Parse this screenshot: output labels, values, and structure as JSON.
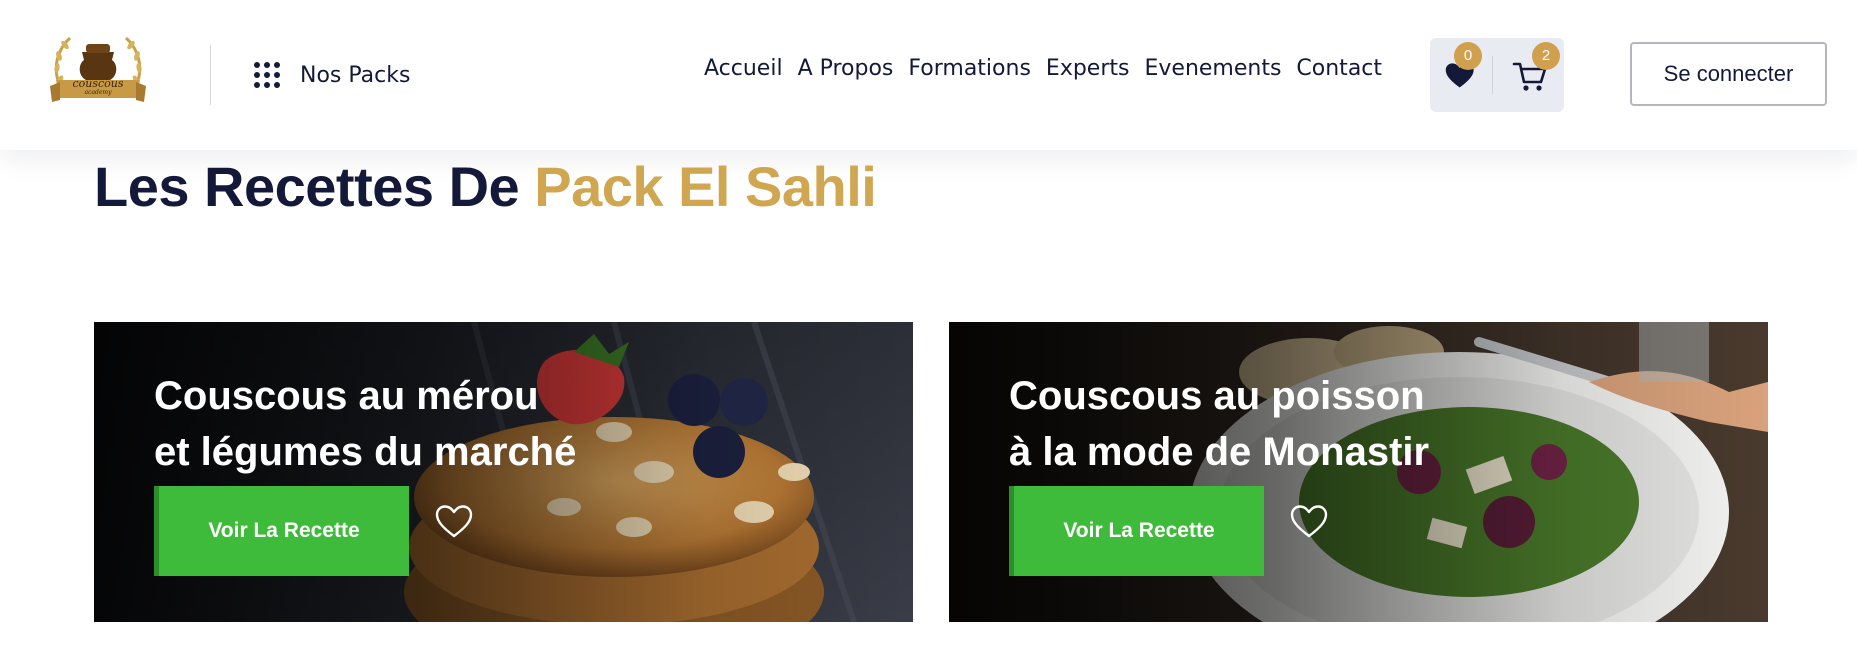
{
  "logo": {
    "word": "couscous",
    "sub": "academy"
  },
  "header": {
    "packs_label": "Nos Packs",
    "nav": [
      {
        "label": "Accueil"
      },
      {
        "label": "A Propos"
      },
      {
        "label": "Formations"
      },
      {
        "label": "Experts"
      },
      {
        "label": "Evenements"
      },
      {
        "label": "Contact"
      }
    ],
    "wishlist_count": "0",
    "cart_count": "2",
    "login_label": "Se connecter"
  },
  "page": {
    "title_part1": "Les Recettes De",
    "title_part2": "Pack El Sahli"
  },
  "recipes": [
    {
      "title_line1": "Couscous au mérou",
      "title_line2": "et légumes du marché",
      "button_label": "Voir La Recette",
      "fav_icon": "heart-outline-icon"
    },
    {
      "title_line1": "Couscous au poisson",
      "title_line2": "à la mode de Monastir",
      "button_label": "Voir La Recette",
      "fav_icon": "heart-outline-icon"
    }
  ],
  "colors": {
    "navy": "#14193a",
    "gold": "#d0a651",
    "green_button": "#3fbb3b",
    "badge": "#d0a04f",
    "icon_box": "#e9ebf2"
  }
}
